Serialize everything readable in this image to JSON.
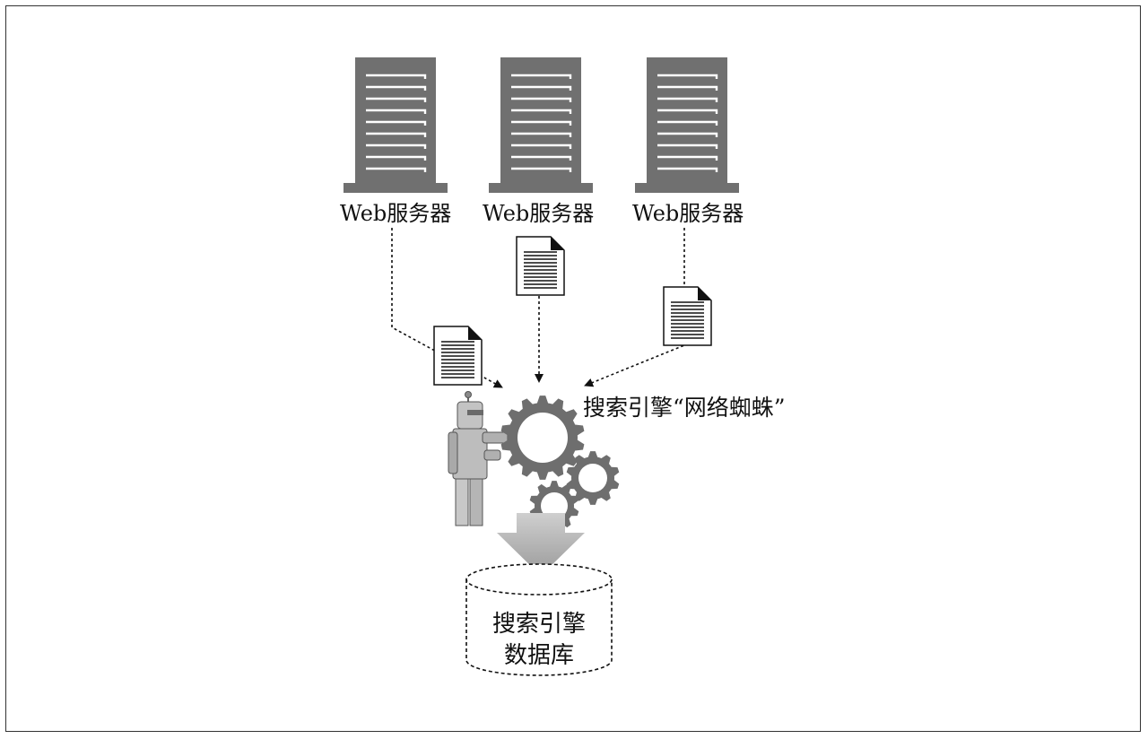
{
  "servers": [
    {
      "label": "Web服务器"
    },
    {
      "label": "Web服务器"
    },
    {
      "label": "Web服务器"
    }
  ],
  "crawler": {
    "label": "搜索引擎“网络蜘蛛”"
  },
  "database": {
    "line1": "搜索引擎",
    "line2": "数据库"
  },
  "colors": {
    "server": "#707070",
    "gear": "#6e6e6e",
    "robot": "#bdbdbd",
    "line": "#111111"
  }
}
